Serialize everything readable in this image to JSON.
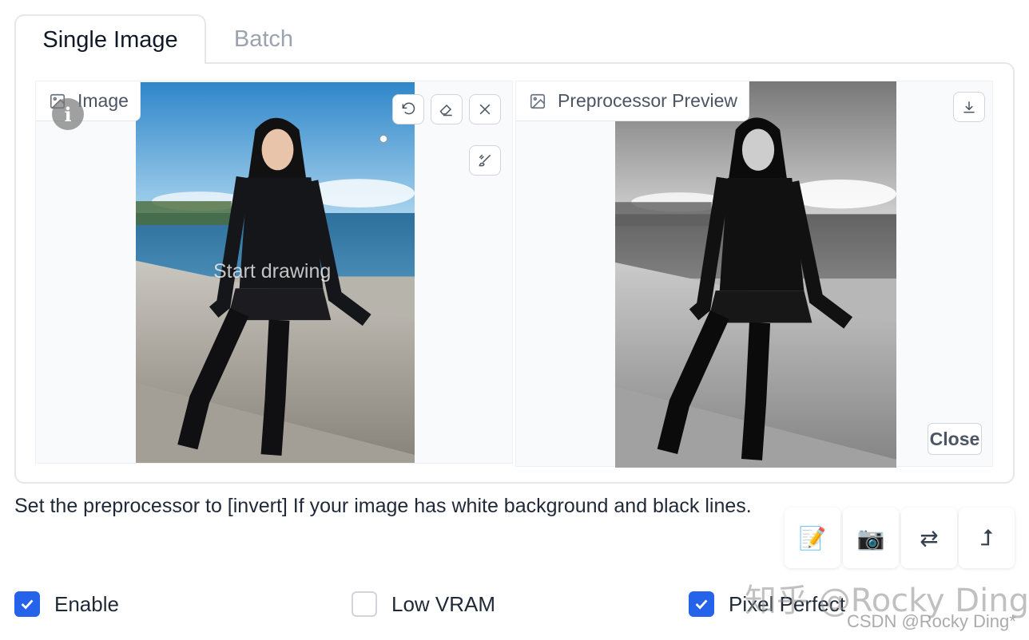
{
  "tabs": {
    "single": "Single Image",
    "batch": "Batch"
  },
  "left_panel": {
    "label": "Image",
    "overlay_text": "Start drawing",
    "info_badge": "i",
    "icons": [
      "image-icon",
      "undo-icon",
      "eraser-icon",
      "close-icon",
      "brush-icon"
    ]
  },
  "right_panel": {
    "label": "Preprocessor Preview",
    "close_label": "Close",
    "icons": [
      "image-icon",
      "download-icon"
    ]
  },
  "hint": "Set the preprocessor to [invert] If your image has white background and black lines.",
  "tool_buttons": [
    {
      "name": "memo-icon",
      "glyph": "📝"
    },
    {
      "name": "camera-icon",
      "glyph": "📷"
    },
    {
      "name": "swap-icon",
      "glyph": "⇄"
    },
    {
      "name": "send-up-icon",
      "glyph": "⮥"
    }
  ],
  "checkboxes": [
    {
      "label": "Enable",
      "checked": true
    },
    {
      "label": "Low VRAM",
      "checked": false
    },
    {
      "label": "Pixel Perfect",
      "checked": true
    }
  ],
  "watermarks": {
    "zhihu": "知乎 @Rocky Ding",
    "csdn": "CSDN @Rocky Ding*"
  },
  "colors": {
    "accent": "#2563eb",
    "border": "#e5e7eb"
  }
}
